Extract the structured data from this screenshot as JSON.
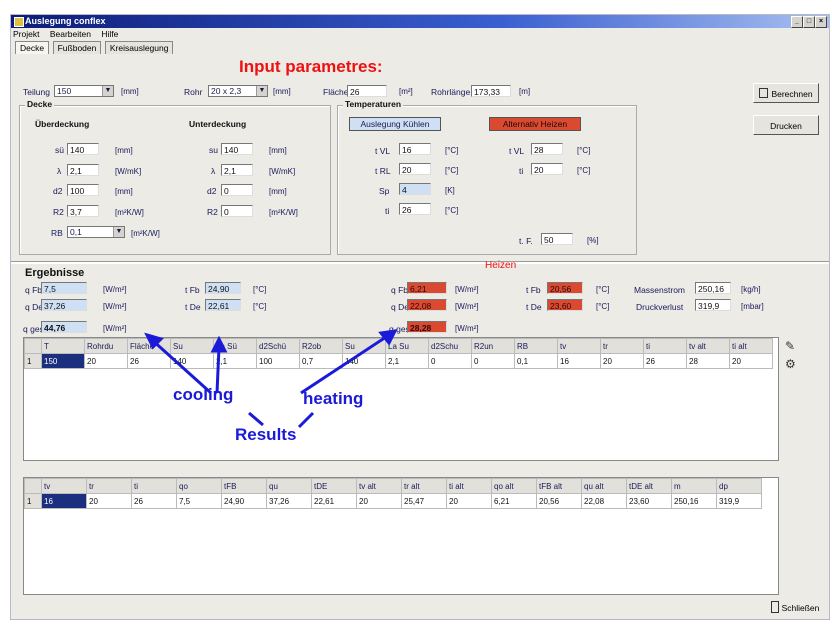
{
  "window": {
    "title": "Auslegung conflex",
    "buttons": [
      "_",
      "□",
      "×"
    ]
  },
  "menu": [
    "Projekt",
    "Bearbeiten",
    "Hilfe"
  ],
  "tabs": [
    "Decke",
    "Fußboden",
    "Kreisauslegung"
  ],
  "annotations": {
    "input": "Input parametres:",
    "cooling": "cooling",
    "heating": "heating",
    "results": "Results",
    "heizen": "Heizen"
  },
  "top": {
    "teilung": {
      "label": "Teilung",
      "value": "150",
      "unit": "[mm]"
    },
    "rohr": {
      "label": "Rohr",
      "value": "20 x 2,3",
      "unit": "[mm]"
    },
    "flaeche": {
      "label": "Fläche",
      "value": "26",
      "unit": "[m²]"
    },
    "rohrlaenge": {
      "label": "Rohrlänge",
      "value": "173,33",
      "unit": "[m]"
    }
  },
  "decke": {
    "title": "Decke",
    "ueber": {
      "title": "Überdeckung",
      "rows": [
        {
          "label": "sü",
          "value": "140",
          "unit": "[mm]"
        },
        {
          "label": "λ",
          "value": "2,1",
          "unit": "[W/mK]"
        },
        {
          "label": "d2",
          "value": "100",
          "unit": "[mm]"
        },
        {
          "label": "R2",
          "value": "3,7",
          "unit": "[m²K/W]"
        }
      ]
    },
    "unter": {
      "title": "Unterdeckung",
      "rows": [
        {
          "label": "su",
          "value": "140",
          "unit": "[mm]"
        },
        {
          "label": "λ",
          "value": "2,1",
          "unit": "[W/mK]"
        },
        {
          "label": "d2",
          "value": "0",
          "unit": "[mm]"
        },
        {
          "label": "R2",
          "value": "0",
          "unit": "[m²K/W]"
        }
      ]
    },
    "rb": {
      "label": "RB",
      "value": "0,1",
      "unit": "[m²K/W]"
    }
  },
  "temperaturen": {
    "title": "Temperaturen",
    "kuehlen": {
      "button": "Auslegung Kühlen",
      "rows": [
        {
          "label": "t VL",
          "value": "16",
          "unit": "[°C]"
        },
        {
          "label": "t RL",
          "value": "20",
          "unit": "[°C]"
        },
        {
          "label": "Sp",
          "value": "4",
          "unit": "[K]"
        },
        {
          "label": "ti",
          "value": "26",
          "unit": "[°C]"
        }
      ]
    },
    "heizen": {
      "button": "Alternativ Heizen",
      "rows": [
        {
          "label": "t VL",
          "value": "28",
          "unit": "[°C]"
        },
        {
          "label": "ti",
          "value": "20",
          "unit": "[°C]"
        }
      ]
    },
    "tf": {
      "label": "t. F.",
      "value": "50",
      "unit": "[%]"
    }
  },
  "buttons": {
    "berechnen": "Berechnen",
    "drucken": "Drucken",
    "schliessen": "Schließen"
  },
  "ergebnisse": {
    "title": "Ergebnisse",
    "kuehlen": [
      {
        "label": "q Fb",
        "value": "7,5",
        "unit": "[W/m²]"
      },
      {
        "label": "q De",
        "value": "37,26",
        "unit": "[W/m²]"
      },
      {
        "label": "q ges",
        "value": "44,76",
        "unit": "[W/m²]"
      }
    ],
    "kuehlen_t": [
      {
        "label": "t Fb",
        "value": "24,90",
        "unit": "[°C]"
      },
      {
        "label": "t De",
        "value": "22,61",
        "unit": "[°C]"
      }
    ],
    "heizen": [
      {
        "label": "q Fb",
        "value": "6,21",
        "unit": "[W/m²]"
      },
      {
        "label": "q De",
        "value": "22,08",
        "unit": "[W/m²]"
      },
      {
        "label": "q ges",
        "value": "28,28",
        "unit": "[W/m²]"
      }
    ],
    "heizen_t": [
      {
        "label": "t Fb",
        "value": "20,56",
        "unit": "[°C]"
      },
      {
        "label": "t De",
        "value": "23,60",
        "unit": "[°C]"
      }
    ],
    "massenstrom": {
      "label": "Massenstrom",
      "value": "250,16",
      "unit": "[kg/h]"
    },
    "druckverlust": {
      "label": "Druckverlust",
      "value": "319,9",
      "unit": "[mbar]"
    }
  },
  "table1": {
    "headers": [
      "T",
      "Rohrdu",
      "Fläche",
      "Su",
      "La Sü",
      "d2Schü",
      "R2ob",
      "Su",
      "La Su",
      "d2Schu",
      "R2un",
      "RB",
      "tv",
      "tr",
      "ti",
      "tv alt",
      "ti alt"
    ],
    "row_index": "1",
    "row": [
      "150",
      "20",
      "26",
      "140",
      "2,1",
      "100",
      "0,7",
      "140",
      "2,1",
      "0",
      "0",
      "0,1",
      "16",
      "20",
      "26",
      "28",
      "20"
    ]
  },
  "table2": {
    "headers": [
      "tv",
      "tr",
      "ti",
      "qo",
      "tFB",
      "qu",
      "tDE",
      "tv alt",
      "tr alt",
      "ti alt",
      "qo alt",
      "tFB alt",
      "qu alt",
      "tDE alt",
      "m",
      "dp"
    ],
    "row_index": "1",
    "row": [
      "16",
      "20",
      "26",
      "7,5",
      "24,90",
      "37,26",
      "22,61",
      "20",
      "25,47",
      "20",
      "6,21",
      "20,56",
      "22,08",
      "23,60",
      "250,16",
      "319,9"
    ]
  },
  "colors": {
    "accent_red": "#d94a30",
    "annotation_blue": "#1a1ad8",
    "annotation_red": "#ee1111",
    "field_blue": "#cfe0f4"
  }
}
